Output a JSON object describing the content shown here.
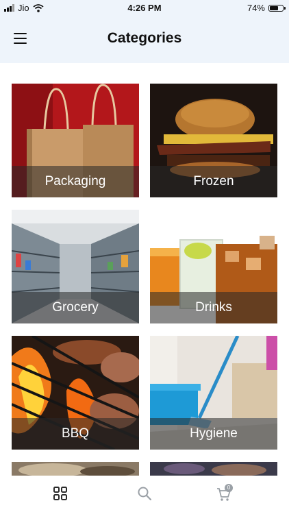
{
  "status_bar": {
    "carrier": "Jio",
    "time": "4:26 PM",
    "battery_percent": "74%",
    "battery_level": 0.74
  },
  "header": {
    "title": "Categories",
    "menu_icon": "hamburger-menu-icon"
  },
  "categories": [
    {
      "label": "Packaging"
    },
    {
      "label": "Frozen"
    },
    {
      "label": "Grocery"
    },
    {
      "label": "Drinks"
    },
    {
      "label": "BBQ"
    },
    {
      "label": "Hygiene"
    }
  ],
  "bottom_nav": {
    "tabs": [
      {
        "icon": "grid-icon",
        "active": true
      },
      {
        "icon": "search-icon",
        "active": false
      },
      {
        "icon": "cart-icon",
        "active": false
      }
    ],
    "cart_badge": "0"
  },
  "colors": {
    "header_bg": "#eef4fb",
    "active_icon": "#2b2b2b",
    "inactive_icon": "#9aa0a6"
  }
}
